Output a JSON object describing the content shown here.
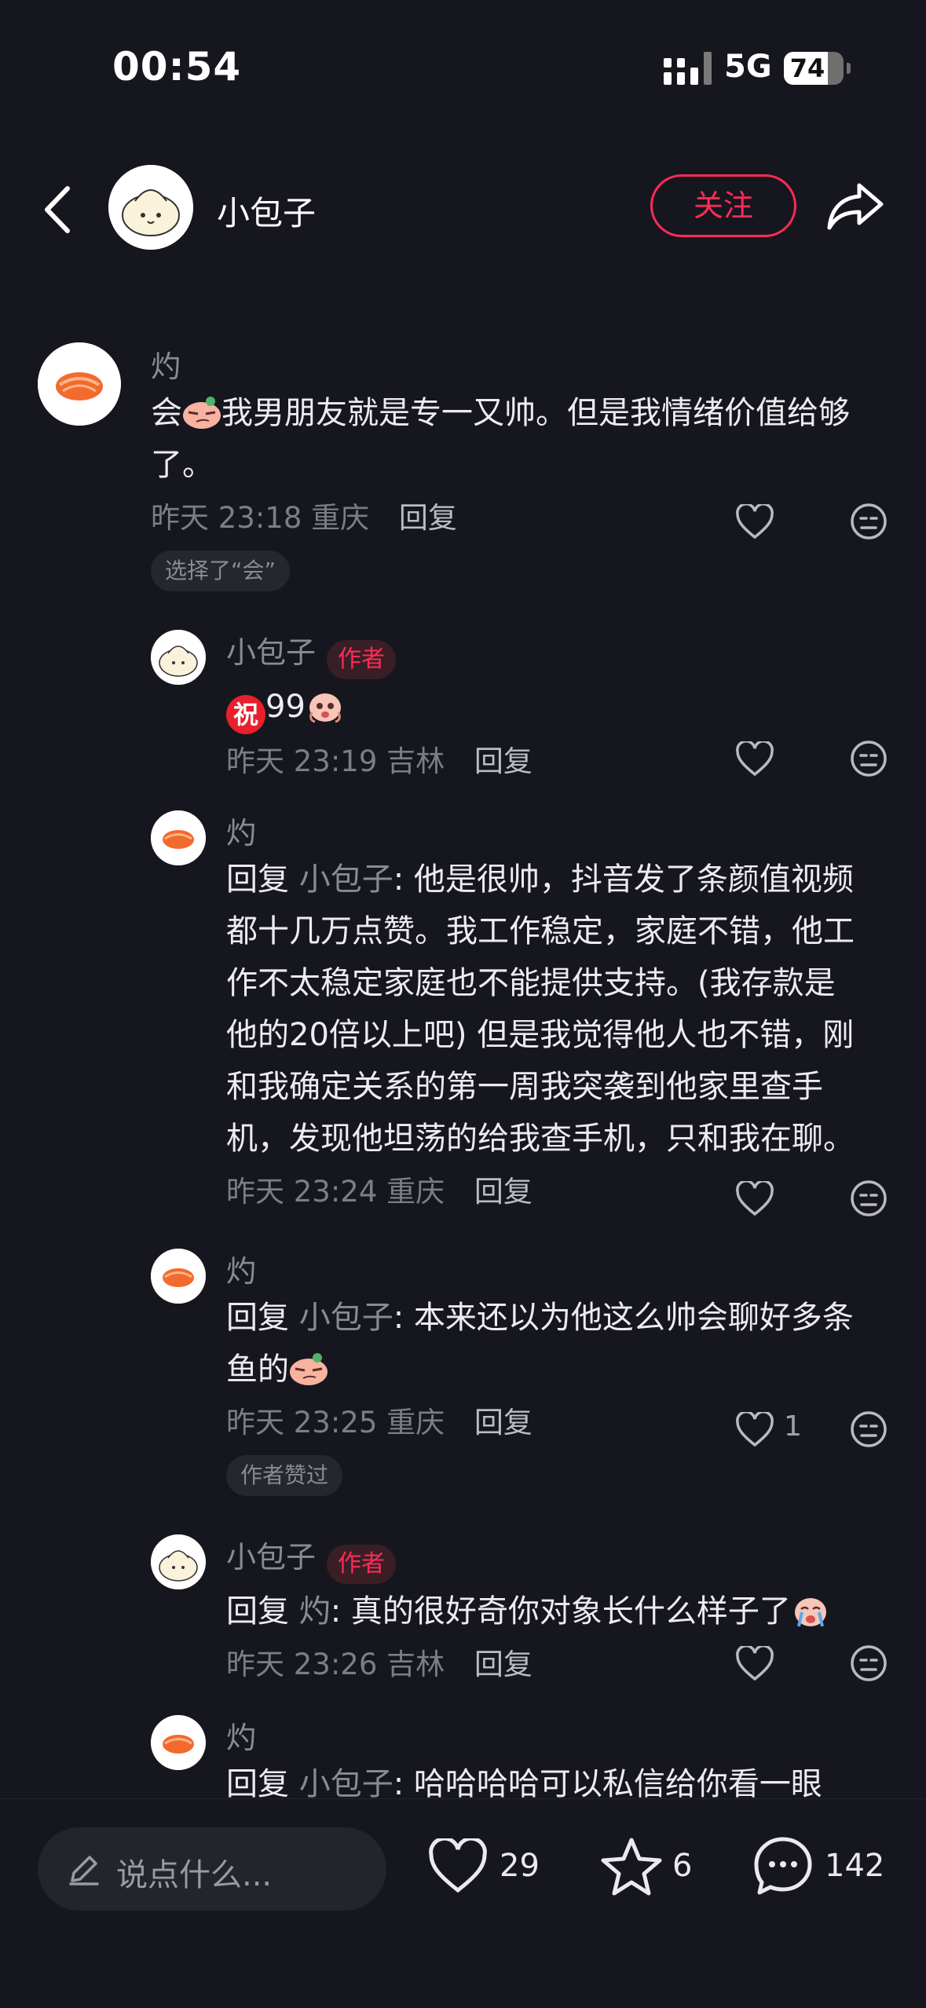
{
  "status": {
    "time": "00:54",
    "network": "5G",
    "battery": "74",
    "battery_level": 0.74
  },
  "header": {
    "title": "小包子",
    "follow_label": "关注"
  },
  "comments": [
    {
      "user": "灼",
      "text": "会😏我男朋友就是专一又帅。但是我情绪价值给够了。",
      "line1": "会",
      "line1b": "我男朋友就是专一又帅。但是我情绪价值给够",
      "line2": "了。",
      "time": "昨天 23:18",
      "location": "重庆",
      "reply": "回复",
      "chip": "选择了“会”"
    },
    {
      "user": "小包子",
      "tag": "作者",
      "badge": "祝",
      "text": "99",
      "time": "昨天 23:19",
      "location": "吉林",
      "reply": "回复"
    },
    {
      "user": "灼",
      "prefix": "回复 ",
      "target": "小包子",
      "lines": [
        ": 他是很帅，抖音发了条颜值视频",
        "都十几万点赞。我工作稳定，家庭不错，他工",
        "作不太稳定家庭也不能提供支持。(我存款是",
        "他的20倍以上吧) 但是我觉得他人也不错，刚",
        "和我确定关系的第一周我突袭到他家里查手",
        "机，发现他坦荡的给我查手机，只和我在聊。"
      ],
      "time": "昨天 23:24",
      "location": "重庆",
      "reply": "回复"
    },
    {
      "user": "灼",
      "prefix": "回复 ",
      "target": "小包子",
      "line1": ": 本来还以为他这么帅会聊好多条",
      "line2": "鱼的",
      "time": "昨天 23:25",
      "location": "重庆",
      "reply": "回复",
      "likes": "1",
      "chip": "作者赞过"
    },
    {
      "user": "小包子",
      "tag": "作者",
      "prefix": "回复 ",
      "target": "灼",
      "line1": ": 真的很好奇你对象长什么样子了",
      "time": "昨天 23:26",
      "location": "吉林",
      "reply": "回复"
    },
    {
      "user": "灼",
      "prefix": "回复 ",
      "target": "小包子",
      "line1": ": 哈哈哈哈可以私信给你看一眼"
    }
  ],
  "bottom": {
    "placeholder": "说点什么...",
    "likes": "29",
    "favorites": "6",
    "comments": "142"
  },
  "colors": {
    "accent": "#fe2c55",
    "background": "#16161f"
  },
  "icons": [
    "back-icon",
    "share-icon",
    "heart-icon",
    "dislike-icon",
    "pencil-icon",
    "star-icon",
    "comment-bubble-icon"
  ]
}
